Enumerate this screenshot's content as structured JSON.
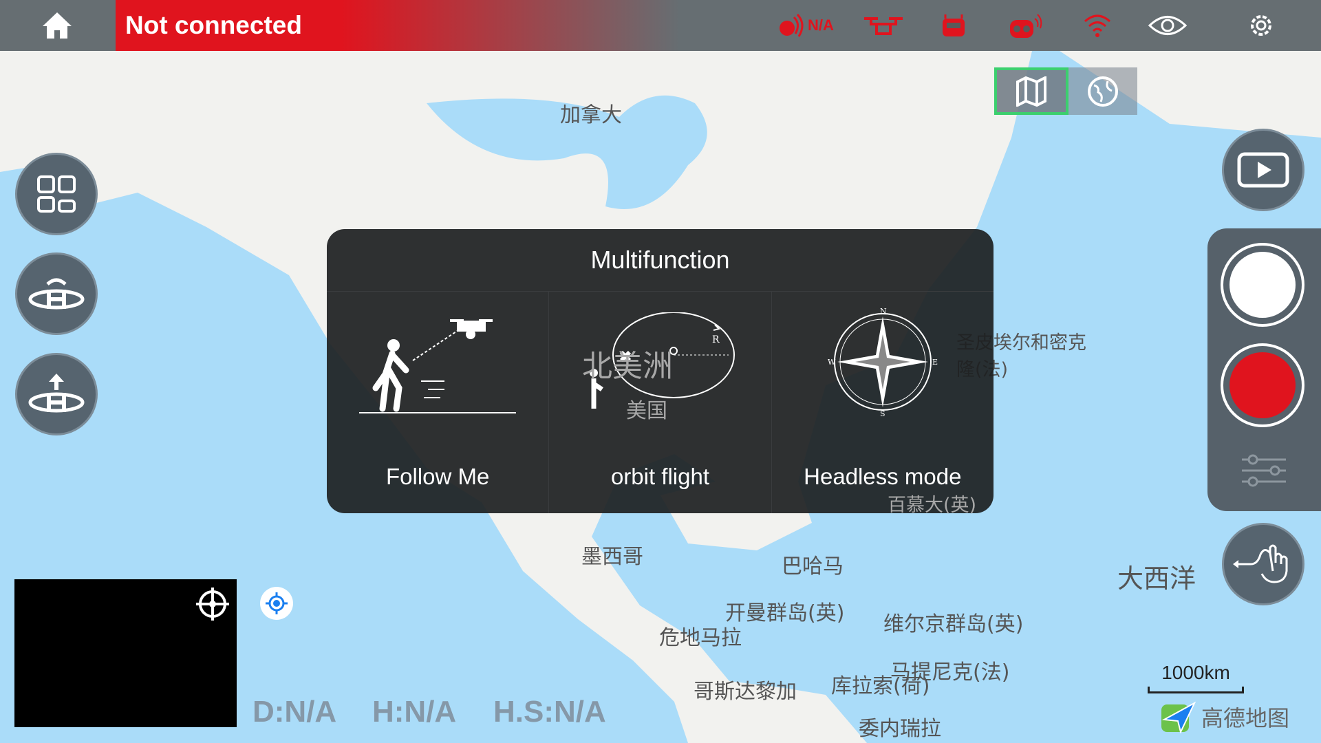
{
  "topbar": {
    "status": "Not connected",
    "signal_value": "N/A",
    "icons": [
      "home-icon",
      "rc-signal-icon",
      "drone-icon",
      "remote-controller-icon",
      "camera-signal-icon",
      "wifi-icon",
      "eye-icon",
      "gear-icon"
    ]
  },
  "colors": {
    "alert": "#e0141e",
    "button": "#56646f",
    "active": "#3ccf6e"
  },
  "map_toggle": {
    "options": [
      "map-icon",
      "globe-icon"
    ],
    "selected": "map"
  },
  "map": {
    "labels": [
      "加拿大",
      "北美洲",
      "美国",
      "墨西哥",
      "巴哈马",
      "开曼群岛(英)",
      "危地马拉",
      "维尔京群岛(英)",
      "马提尼克(法)",
      "哥斯达黎加",
      "库拉索(荷)",
      "委内瑞拉",
      "大西洋",
      "圣皮埃尔和密克隆(法)",
      "百慕大(英)"
    ],
    "scale": "1000km",
    "provider": "高德地图"
  },
  "dialog": {
    "title": "Multifunction",
    "items": [
      {
        "label": "Follow Me"
      },
      {
        "label": "orbit flight"
      },
      {
        "label": "Headless mode"
      }
    ]
  },
  "telemetry": {
    "distance": "D:N/A",
    "height": "H:N/A",
    "hspeed": "H.S:N/A"
  }
}
